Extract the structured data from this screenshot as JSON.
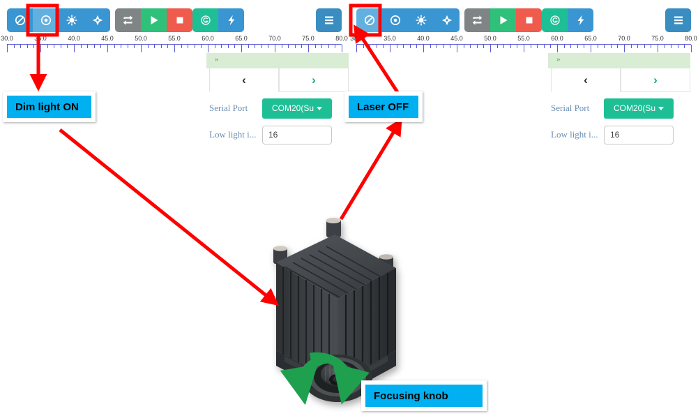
{
  "app": {
    "toolbar": {
      "mode_group": [
        {
          "name": "laser-off",
          "icon": "prohibited-icon",
          "color": "#3a96d2",
          "selected_left": false,
          "selected_right": true
        },
        {
          "name": "dim-light",
          "icon": "dot-target-icon",
          "color": "#3a96d2",
          "selected_left": true,
          "selected_right": false
        },
        {
          "name": "full-light",
          "icon": "sun-icon",
          "color": "#3a96d2",
          "selected_left": false,
          "selected_right": false
        },
        {
          "name": "crosshair",
          "icon": "crosshair-icon",
          "color": "#3a96d2",
          "selected_left": false,
          "selected_right": false
        }
      ],
      "run_group": [
        {
          "name": "loop",
          "icon": "repeat-icon",
          "color": "#7f8585"
        },
        {
          "name": "start",
          "icon": "play-icon",
          "color": "#2fc07a"
        },
        {
          "name": "stop",
          "icon": "stop-icon",
          "color": "#ef5b4c"
        }
      ],
      "aux_group": [
        {
          "name": "origin",
          "icon": "target-g-icon",
          "color": "#1fbf96"
        },
        {
          "name": "power",
          "icon": "lightning-icon",
          "color": "#3a96d2"
        }
      ],
      "menu_button": {
        "name": "menu",
        "icon": "hamburger-icon",
        "color": "#3a8dc0"
      }
    },
    "ruler": {
      "min": 30.0,
      "max": 80.0,
      "major_step": 5.0,
      "minor_step": 1.0,
      "labels": [
        "30.0",
        "35.0",
        "40.0",
        "45.0",
        "50.0",
        "55.0",
        "60.0",
        "65.0",
        "70.0",
        "75.0",
        "80.0"
      ],
      "tick_color": "#5b5bd6"
    },
    "panel": {
      "collapse_chevron": "»",
      "header_color": "#d9ecd4",
      "tabs": [
        {
          "name": "prev-tab",
          "glyph": "‹",
          "active": true
        },
        {
          "name": "next-tab",
          "glyph": "›",
          "active": false
        }
      ],
      "fields": [
        {
          "label": "Serial Port",
          "type": "dropdown",
          "value": "COM20(Su",
          "color": "#1fbf96"
        },
        {
          "label": "Low light i...",
          "type": "number",
          "value": "16",
          "placeholder": "16"
        }
      ]
    }
  },
  "annotations": {
    "callouts": [
      {
        "name": "dim-light-on",
        "text": "Dim light ON",
        "bg": "#00b0f0"
      },
      {
        "name": "laser-off",
        "text": "Laser OFF",
        "bg": "#00b0f0"
      },
      {
        "name": "focusing-knob",
        "text": "Focusing knob",
        "bg": "#00b0f0"
      }
    ],
    "arrow_color": "#ff0000",
    "highlight_color": "#ff0000",
    "rotation_arrow_color": "#1fa04f"
  },
  "artwork": {
    "name": "laser-module-photo",
    "body_color": "#3a3d40",
    "description": "Laser module with heatsink fins and focusing knob"
  }
}
